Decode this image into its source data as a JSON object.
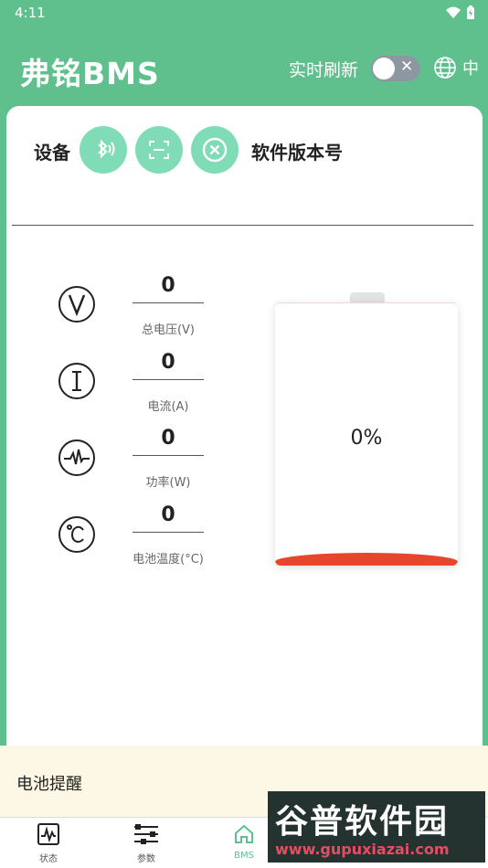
{
  "status_bar": {
    "time": "4:11"
  },
  "header": {
    "title": "弗铭BMS",
    "refresh_label": "实时刷新",
    "language_label": "中"
  },
  "device": {
    "label": "设备",
    "version_label": "软件版本号"
  },
  "metrics": [
    {
      "value": "0",
      "label": "总电压(V)",
      "icon": "voltage-icon"
    },
    {
      "value": "0",
      "label": "电流(A)",
      "icon": "current-icon"
    },
    {
      "value": "0",
      "label": "功率(W)",
      "icon": "power-icon"
    },
    {
      "value": "0",
      "label": "电池温度(°C)",
      "icon": "temperature-icon"
    }
  ],
  "battery": {
    "percent_text": "0%",
    "level": 0
  },
  "reminder": {
    "title": "电池提醒"
  },
  "nav": [
    {
      "label": "状态"
    },
    {
      "label": "参数"
    },
    {
      "label": "BMS"
    }
  ],
  "watermark": {
    "title": "谷普软件园",
    "url": "www.gupuxiazai.com"
  },
  "colors": {
    "accent": "#5fc08e",
    "button": "#7fdcb6",
    "battery_fill": "#e8462c"
  }
}
